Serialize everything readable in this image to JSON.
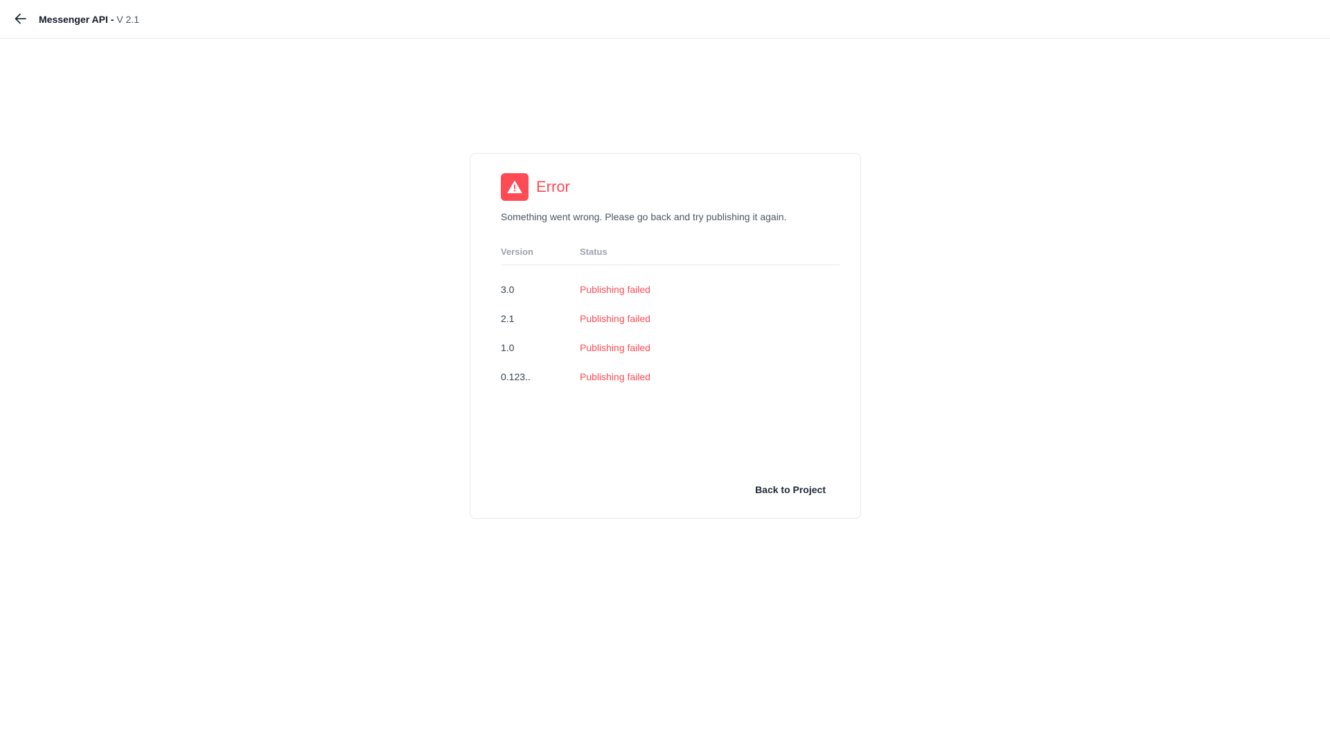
{
  "header": {
    "back_icon": "arrow-left-icon",
    "app_name": "Messenger API",
    "separator": " - ",
    "version": "V 2.1"
  },
  "dialog": {
    "icon": "warning-triangle-icon",
    "accent_color": "#ff4b55",
    "title": "Error",
    "description": "Something went wrong. Please go back and try publishing it again.",
    "columns": [
      "Version",
      "Status"
    ],
    "rows": [
      {
        "version": "3.0",
        "status": "Publishing failed"
      },
      {
        "version": "2.1",
        "status": "Publishing failed"
      },
      {
        "version": "1.0",
        "status": "Publishing failed"
      },
      {
        "version": "0.123..",
        "status": "Publishing failed"
      }
    ],
    "back_button_label": "Back to Project"
  }
}
